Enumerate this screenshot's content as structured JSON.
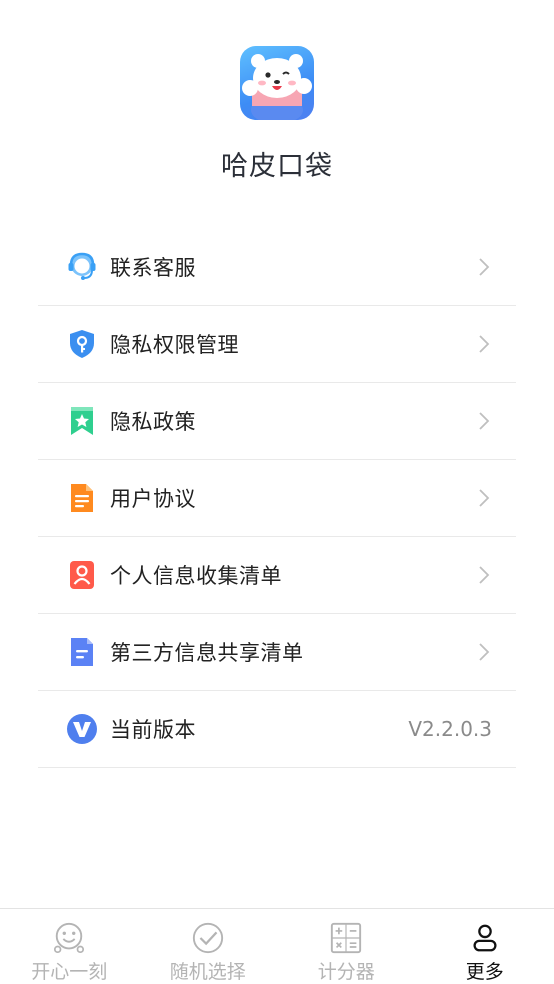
{
  "app": {
    "name": "哈皮口袋"
  },
  "menu": {
    "items": [
      {
        "label": "联系客服",
        "icon": "customer-service-icon",
        "color": "#3aa0f5"
      },
      {
        "label": "隐私权限管理",
        "icon": "shield-key-icon",
        "color": "#3b8ff0"
      },
      {
        "label": "隐私政策",
        "icon": "star-bookmark-icon",
        "color": "#2fcf8f"
      },
      {
        "label": "用户协议",
        "icon": "document-icon",
        "color": "#ff8a1f"
      },
      {
        "label": "个人信息收集清单",
        "icon": "person-card-icon",
        "color": "#ff5a4a"
      },
      {
        "label": "第三方信息共享清单",
        "icon": "list-doc-icon",
        "color": "#5b82f5"
      }
    ],
    "version_label": "当前版本",
    "version_value": "V2.2.0.3",
    "version_icon": "v-logo-icon"
  },
  "tabbar": {
    "tabs": [
      {
        "label": "开心一刻",
        "icon": "smile-face-icon",
        "active": false
      },
      {
        "label": "随机选择",
        "icon": "check-circle-icon",
        "active": false
      },
      {
        "label": "计分器",
        "icon": "calculator-icon",
        "active": false
      },
      {
        "label": "更多",
        "icon": "person-icon",
        "active": true
      }
    ]
  }
}
